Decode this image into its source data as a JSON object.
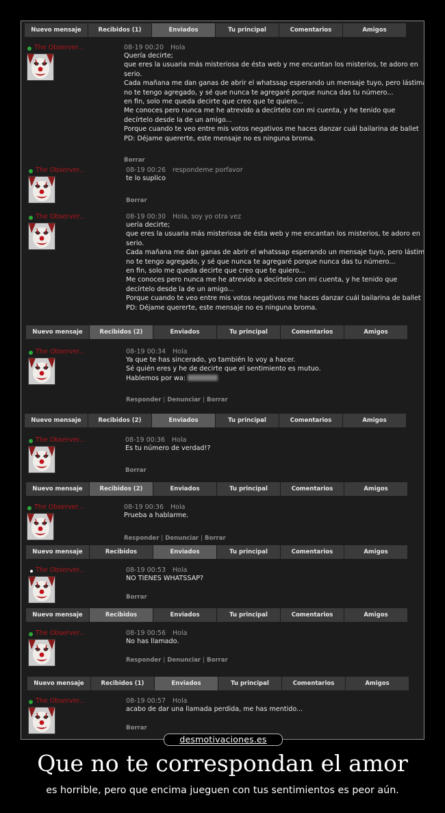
{
  "tab_bars": [
    [
      "Nuevo mensaje",
      "Recibidos (1)",
      "Enviados",
      "Tu principal",
      "Comentarios",
      "Amigos"
    ],
    [
      "Nuevo mensaje",
      "Recibidos (2)",
      "Enviados",
      "Tu principal",
      "Comentarios",
      "Amigos"
    ],
    [
      "Nuevo mensaje",
      "Recibidos (2)",
      "Enviados",
      "Tu principal",
      "Comentarios",
      "Amigos"
    ],
    [
      "Nuevo mensaje",
      "Recibidos (2)",
      "Enviados",
      "Tu principal",
      "Comentarios",
      "Amigos"
    ],
    [
      "Nuevo mensaje",
      "Recibidos",
      "Enviados",
      "Tu principal",
      "Comentarios",
      "Amigos"
    ],
    [
      "Nuevo mensaje",
      "Recibidos",
      "Enviados",
      "Tu principal",
      "Comentarios",
      "Amigos"
    ],
    [
      "Nuevo mensaje",
      "Recibidos (1)",
      "Enviados",
      "Tu principal",
      "Comentarios",
      "Amigos"
    ]
  ],
  "messages": [
    {
      "user": "The Observer...",
      "time": "08-19 00:20",
      "subject": "Hola",
      "lines": [
        "Quería decirte;",
        "que eres la usuaria más misteriosa de ésta web y me encantan los misterios, te adoro en",
        "serio.",
        "Cada mañana me dan ganas de abrir el whatssap esperando un mensaje tuyo, pero lástima,",
        "no te tengo agregado, y sé que nunca te agregaré porque nunca das tu número...",
        "en fin, solo me queda decirte que creo que te quiero...",
        "Me conoces pero nunca me he atrevido a decírtelo con mi cuenta, y he tenido que",
        "decírtelo desde la de un amigo...",
        "Porque cuando te veo entre mis votos negativos me haces danzar cuál bailarina de ballet",
        "PD: Déjame quererte, este mensaje no es ninguna broma."
      ],
      "actions": [
        "Borrar"
      ]
    },
    {
      "user": "The Observer...",
      "time": "08-19 00:26",
      "subject": "respondeme porfavor",
      "lines": [
        "te lo suplico"
      ],
      "actions": [
        "Borrar"
      ]
    },
    {
      "user": "The Observer...",
      "time": "08-19 00:30",
      "subject": "Hola, soy yo otra vez",
      "lines": [
        "uería decirte;",
        "que eres la usuaria más misteriosa de ésta web y me encantan los misterios, te adoro en",
        "serio.",
        "Cada mañana me dan ganas de abrir el whatssap esperando un mensaje tuyo, pero lástima,",
        "no te tengo agregado, y sé que nunca te agregaré porque nunca das tu número...",
        "en fin, solo me queda decirte que creo que te quiero...",
        "Me conoces pero nunca me he atrevido a decírtelo con mi cuenta, y he tenido que",
        "decírtelo desde la de un amigo...",
        "Porque cuando te veo entre mis votos negativos me haces danzar cuál bailarina de ballet",
        "PD: Déjame quererte, este mensaje no es ninguna broma."
      ],
      "actions": []
    },
    {
      "user": "The Observer...",
      "time": "08-19 00:34",
      "subject": "Hola",
      "lines": [
        "Ya que te has sincerado, yo también lo voy a hacer.",
        "Sé quién eres y he de decirte que el sentimiento es mutuo.",
        "Hablemos por wa:"
      ],
      "actions": [
        "Responder",
        "Denunciar",
        "Borrar"
      ]
    },
    {
      "user": "The Observer...",
      "time": "08-19 00:36",
      "subject": "Hola",
      "lines": [
        "Es tu número de verdad!?"
      ],
      "actions": [
        "Borrar"
      ]
    },
    {
      "user": "The Observer...",
      "time": "08-19 00:36",
      "subject": "Hola",
      "lines": [
        "Prueba a hablarme."
      ],
      "actions": [
        "Responder",
        "Denunciar",
        "Borrar"
      ]
    },
    {
      "user": "The Observer...",
      "time": "08-19 00:53",
      "subject": "Hola",
      "lines": [
        "NO TIENES WHATSSAP?"
      ],
      "actions": [
        "Borrar"
      ]
    },
    {
      "user": "The Observer...",
      "time": "08-19 00:56",
      "subject": "Hola",
      "lines": [
        "No has llamado."
      ],
      "actions": [
        "Responder",
        "Denunciar",
        "Borrar"
      ]
    },
    {
      "user": "The Observer...",
      "time": "08-19 00:57",
      "subject": "Hola",
      "lines": [
        "acabo de dar una llamada perdida, me has mentido..."
      ],
      "actions": [
        "Borrar"
      ]
    }
  ],
  "footer": {
    "logo": "desmotivaciones.es",
    "title": "Que no te correspondan el amor",
    "subtitle": "es horrible, pero que encima jueguen con tus sentimientos es peor aún."
  },
  "colors": {
    "username": "#b3151b",
    "online_dot": "#2fa83a",
    "panel_bg": "#1c1c1c",
    "tab_bg": "#3b3b3b",
    "tab_active_bg": "#5b5b5b"
  },
  "icons": {
    "avatar": "clown-avatar-icon",
    "online": "online-dot-icon"
  }
}
